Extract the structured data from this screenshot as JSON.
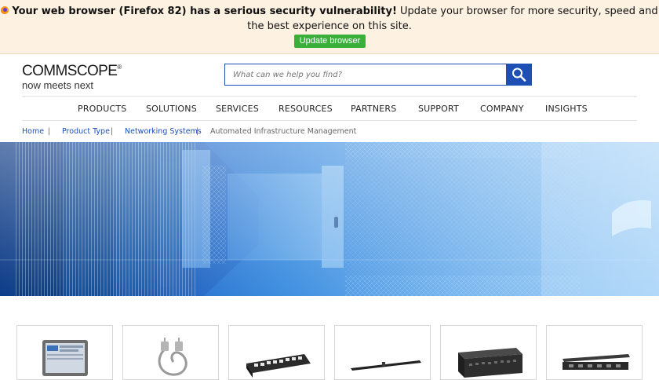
{
  "banner": {
    "bold_text": "Your web browser (Firefox 82) has a serious security vulnerability!",
    "text": " Update your browser for more security, speed and the best experience on this site.",
    "button_label": "Update browser",
    "icon": "firefox-icon"
  },
  "header": {
    "logo_main": "COMMSCOPE",
    "logo_reg": "®",
    "logo_tagline": "now meets next",
    "search_placeholder": "What can we help you find?",
    "search_icon": "search-icon"
  },
  "nav": {
    "items": [
      "PRODUCTS",
      "SOLUTIONS",
      "SERVICES",
      "RESOURCES",
      "PARTNERS",
      "SUPPORT",
      "COMPANY",
      "INSIGHTS"
    ]
  },
  "breadcrumb": {
    "items": [
      "Home",
      "Product Type",
      "Networking Systems",
      "Automated Infrastructure Management"
    ],
    "separator": "|"
  },
  "products": {
    "cards": [
      {
        "image": "touchscreen-controller-image"
      },
      {
        "image": "cable-assembly-image"
      },
      {
        "image": "patch-panel-image"
      },
      {
        "image": "sensor-strip-image"
      },
      {
        "image": "rack-unit-image"
      },
      {
        "image": "panel-bracket-image"
      }
    ]
  },
  "colors": {
    "brand_blue": "#1d4fb5",
    "banner_bg": "#fdf2e2",
    "update_button": "#3ab03a"
  }
}
